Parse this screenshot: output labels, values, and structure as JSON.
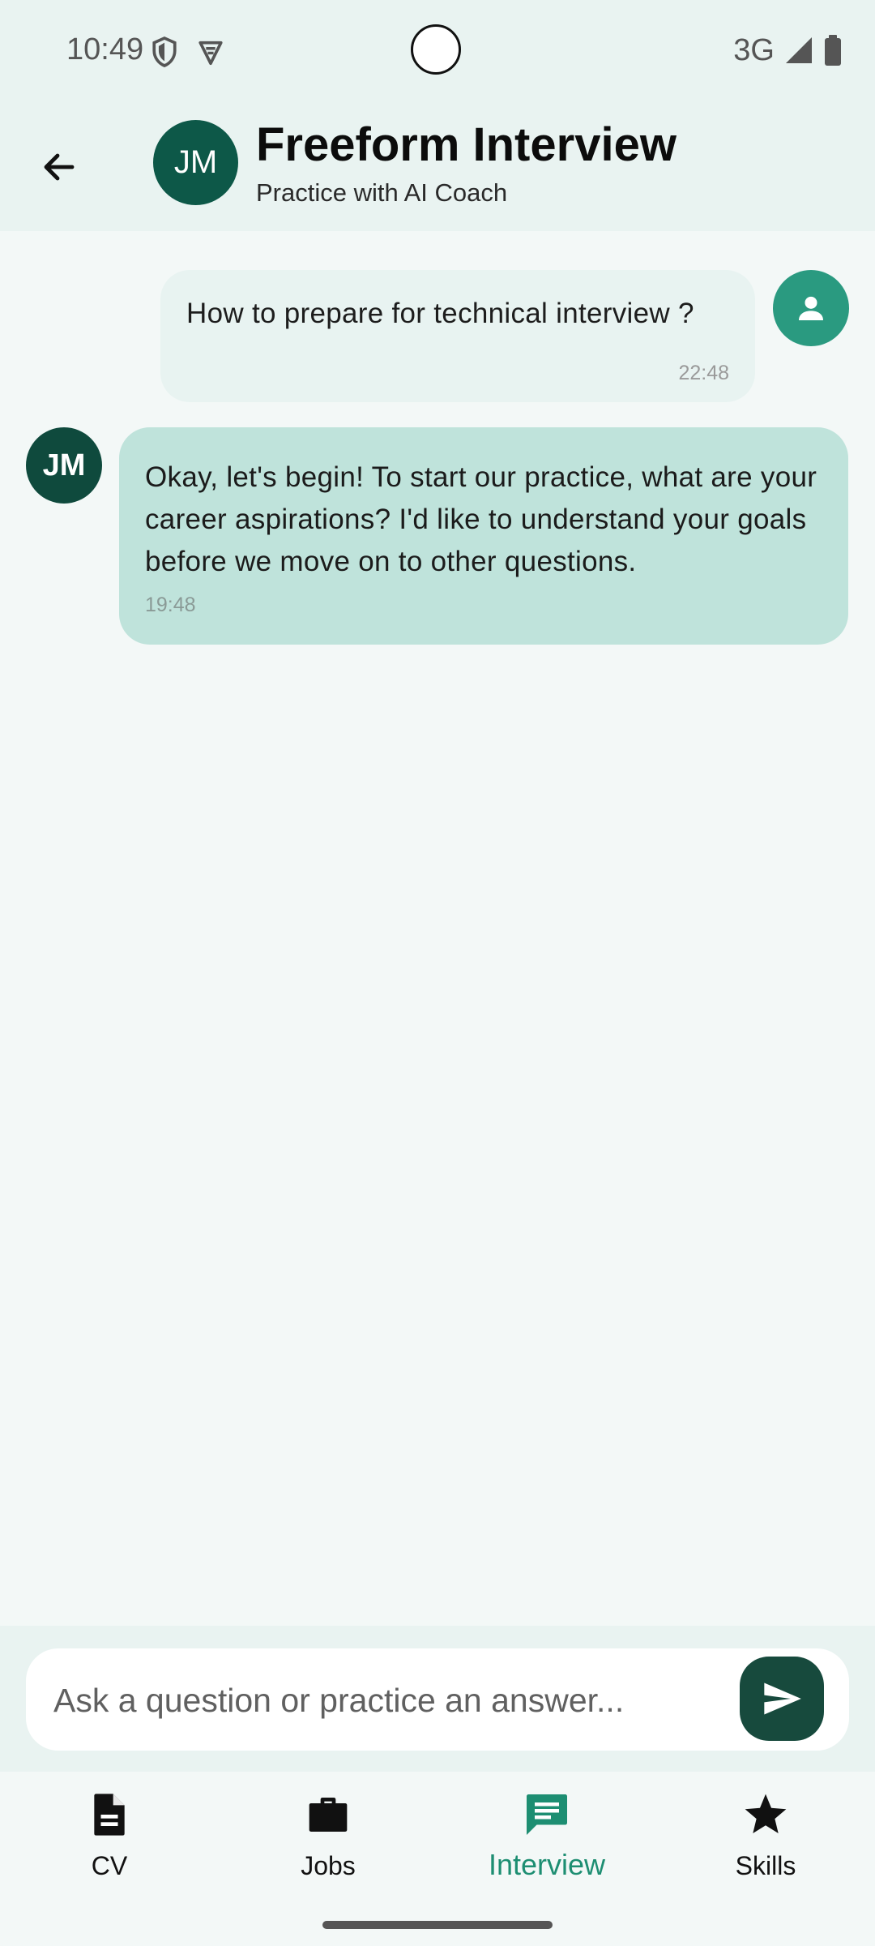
{
  "status_bar": {
    "time": "10:49",
    "network": "3G",
    "icons": [
      "shield-icon",
      "vpn-icon",
      "signal-icon",
      "battery-icon"
    ]
  },
  "header": {
    "avatar_initials": "JM",
    "title": "Freeform Interview",
    "subtitle": "Practice with AI Coach",
    "back_icon": "arrow-back-icon"
  },
  "messages": [
    {
      "sender": "user",
      "text": "How to prepare for technical interview ?",
      "time": "22:48",
      "avatar_icon": "person-icon"
    },
    {
      "sender": "bot",
      "avatar_initials": "JM",
      "text": "Okay, let's begin!  To start our practice, what are your career aspirations?  I'd like to understand your goals before we move on to other questions.",
      "time": "19:48"
    }
  ],
  "composer": {
    "placeholder": "Ask a question or practice an answer...",
    "value": "",
    "send_icon": "send-icon"
  },
  "bottom_nav": {
    "items": [
      {
        "label": "CV",
        "icon": "document-icon",
        "active": false
      },
      {
        "label": "Jobs",
        "icon": "briefcase-icon",
        "active": false
      },
      {
        "label": "Interview",
        "icon": "chat-icon",
        "active": true
      },
      {
        "label": "Skills",
        "icon": "star-icon",
        "active": false
      }
    ]
  },
  "colors": {
    "accent": "#1d8e72",
    "dark_green": "#0f4a3d",
    "bot_bubble": "#bfe3db",
    "user_bubble": "#e8f3f1",
    "background": "#f3f8f7"
  }
}
